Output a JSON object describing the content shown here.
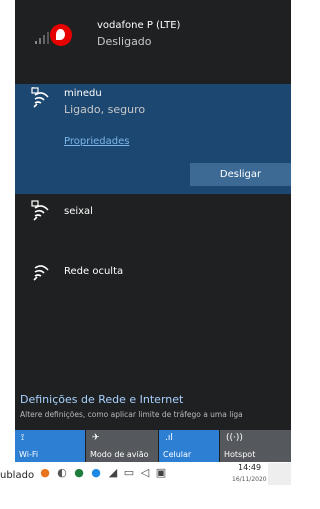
{
  "cellular": {
    "name": "vodafone P (LTE)",
    "status": "Desligado",
    "icons": [
      "signal-bars-icon",
      "vodafone-logo"
    ]
  },
  "connected_network": {
    "name": "minedu",
    "status": "Ligado, seguro",
    "properties_link": "Propriedades",
    "disconnect_button": "Desligar",
    "icon": "wifi-secured-icon"
  },
  "networks": [
    {
      "name": "seixal",
      "icon": "wifi-secured-icon"
    },
    {
      "name": "Rede oculta",
      "icon": "wifi-icon"
    }
  ],
  "settings": {
    "title": "Definições de Rede e Internet",
    "subtitle": "Altere definições, como aplicar limite de tráfego a uma liga"
  },
  "quick_actions": [
    {
      "label": "Wi-Fi",
      "glyph": "⟟",
      "state": "on",
      "icon": "wifi-icon"
    },
    {
      "label": "Modo de avião",
      "glyph": "✈",
      "state": "off",
      "icon": "airplane-icon"
    },
    {
      "label": "Celular",
      "glyph": ".ıl",
      "state": "on",
      "icon": "cellular-icon"
    },
    {
      "label": "Hotspot",
      "glyph": "((·))",
      "state": "off",
      "icon": "hotspot-icon"
    }
  ],
  "taskbar": {
    "left_text": "ublado",
    "time": "14:49",
    "date": "16/11/2020",
    "tray_icons": [
      "network-icon",
      "volume-icon",
      "battery-icon",
      "notification-icon"
    ]
  },
  "colors": {
    "flyout_bg": "#1f2021",
    "selected_bg": "#1c4770",
    "accent": "#2d7fd4",
    "link": "#7bb6ec"
  }
}
